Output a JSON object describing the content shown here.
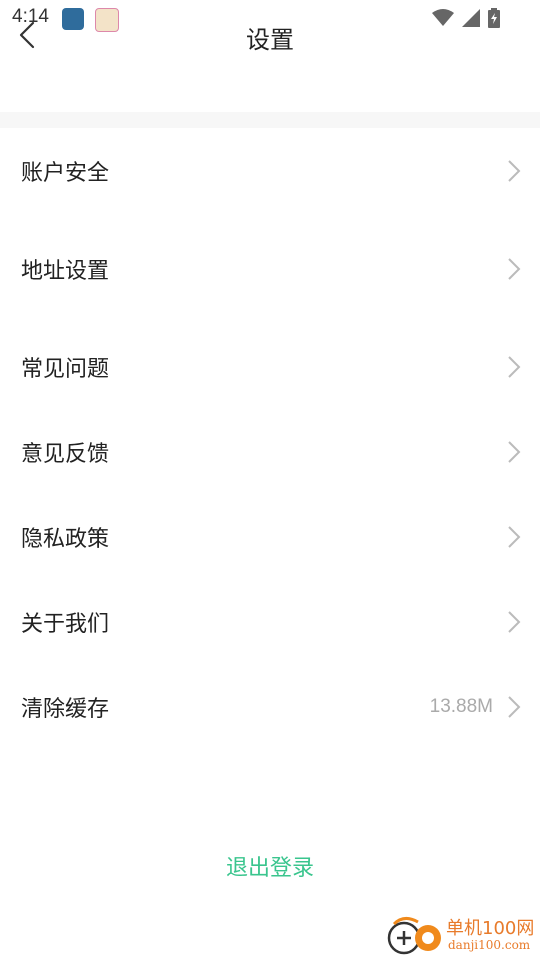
{
  "status": {
    "time": "4:14",
    "icons": [
      "app-icon-1",
      "app-icon-2",
      "wifi-icon",
      "signal-icon",
      "battery-icon"
    ]
  },
  "header": {
    "title": "设置",
    "back_icon": "chevron-left-icon"
  },
  "menu": {
    "items": [
      {
        "label": "账户安全"
      },
      {
        "label": "地址设置"
      },
      {
        "label": "常见问题"
      },
      {
        "label": "意见反馈"
      },
      {
        "label": "隐私政策"
      },
      {
        "label": "关于我们"
      },
      {
        "label": "清除缓存",
        "value": "13.88M"
      }
    ]
  },
  "logout_label": "退出登录",
  "watermark": {
    "name": "单机100网",
    "site": "danji100.com"
  },
  "colors": {
    "accent": "#3ac58e",
    "watermark": "#e87b2b",
    "divider_band": "#f7f7f7"
  }
}
